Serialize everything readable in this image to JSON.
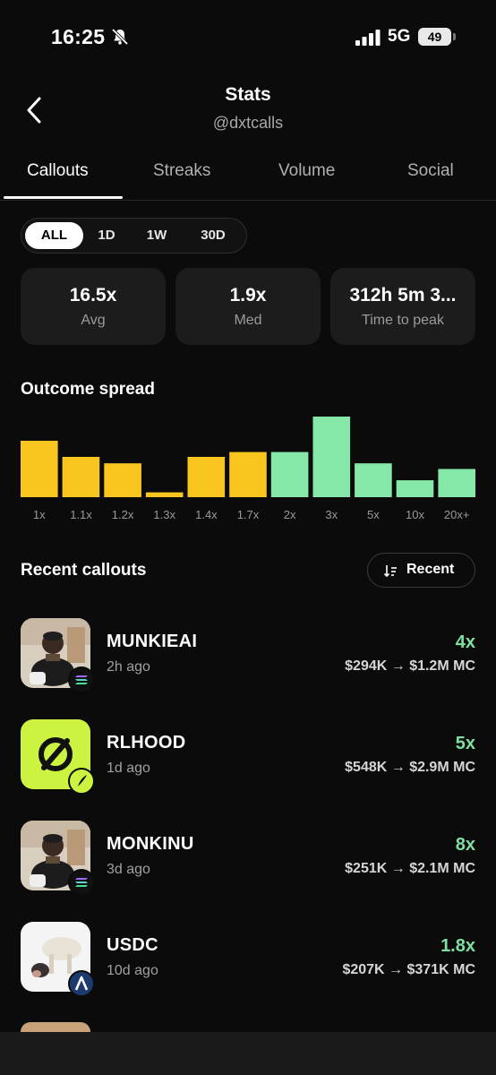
{
  "status_bar": {
    "time": "16:25",
    "network": "5G",
    "battery": "49"
  },
  "header": {
    "title": "Stats",
    "handle": "@dxtcalls"
  },
  "tabs": [
    {
      "label": "Callouts",
      "active": true
    },
    {
      "label": "Streaks",
      "active": false
    },
    {
      "label": "Volume",
      "active": false
    },
    {
      "label": "Social",
      "active": false
    }
  ],
  "filters": [
    {
      "label": "ALL",
      "active": true
    },
    {
      "label": "1D",
      "active": false
    },
    {
      "label": "1W",
      "active": false
    },
    {
      "label": "30D",
      "active": false
    }
  ],
  "stats": [
    {
      "value": "16.5x",
      "label": "Avg"
    },
    {
      "value": "1.9x",
      "label": "Med"
    },
    {
      "value": "312h 5m 3...",
      "label": "Time to peak"
    }
  ],
  "outcome": {
    "title": "Outcome spread",
    "colors": {
      "loss": "#f9c61f",
      "gain": "#86e8a8"
    }
  },
  "chart_data": {
    "type": "bar",
    "title": "Outcome spread",
    "categories": [
      "1x",
      "1.1x",
      "1.2x",
      "1.3x",
      "1.4x",
      "1.7x",
      "2x",
      "3x",
      "5x",
      "10x",
      "20x+"
    ],
    "values": [
      7,
      5,
      4.2,
      0.6,
      5,
      5.6,
      5.6,
      10,
      4.2,
      2.1,
      3.5
    ],
    "groups": [
      "loss",
      "loss",
      "loss",
      "loss",
      "loss",
      "loss",
      "gain",
      "gain",
      "gain",
      "gain",
      "gain"
    ],
    "ylim": [
      0,
      10
    ],
    "grid": false
  },
  "recent": {
    "title": "Recent callouts",
    "sort_label": "Recent",
    "items": [
      {
        "name": "MUNKIEAI",
        "ago": "2h ago",
        "multiple": "4x",
        "from": "$294K",
        "to": "$1.2M",
        "suffix": "MC",
        "thumb": "monkey-photo",
        "chain": "solana"
      },
      {
        "name": "RLHOOD",
        "ago": "1d ago",
        "multiple": "5x",
        "from": "$548K",
        "to": "$2.9M",
        "suffix": "MC",
        "thumb": "robinhood-logo",
        "chain": "robinhood"
      },
      {
        "name": "MONKINU",
        "ago": "3d ago",
        "multiple": "8x",
        "from": "$251K",
        "to": "$2.1M",
        "suffix": "MC",
        "thumb": "monkey-photo",
        "chain": "solana"
      },
      {
        "name": "USDC",
        "ago": "10d ago",
        "multiple": "1.8x",
        "from": "$207K",
        "to": "$371K",
        "suffix": "MC",
        "thumb": "goat-photo",
        "chain": "abstract"
      }
    ]
  }
}
